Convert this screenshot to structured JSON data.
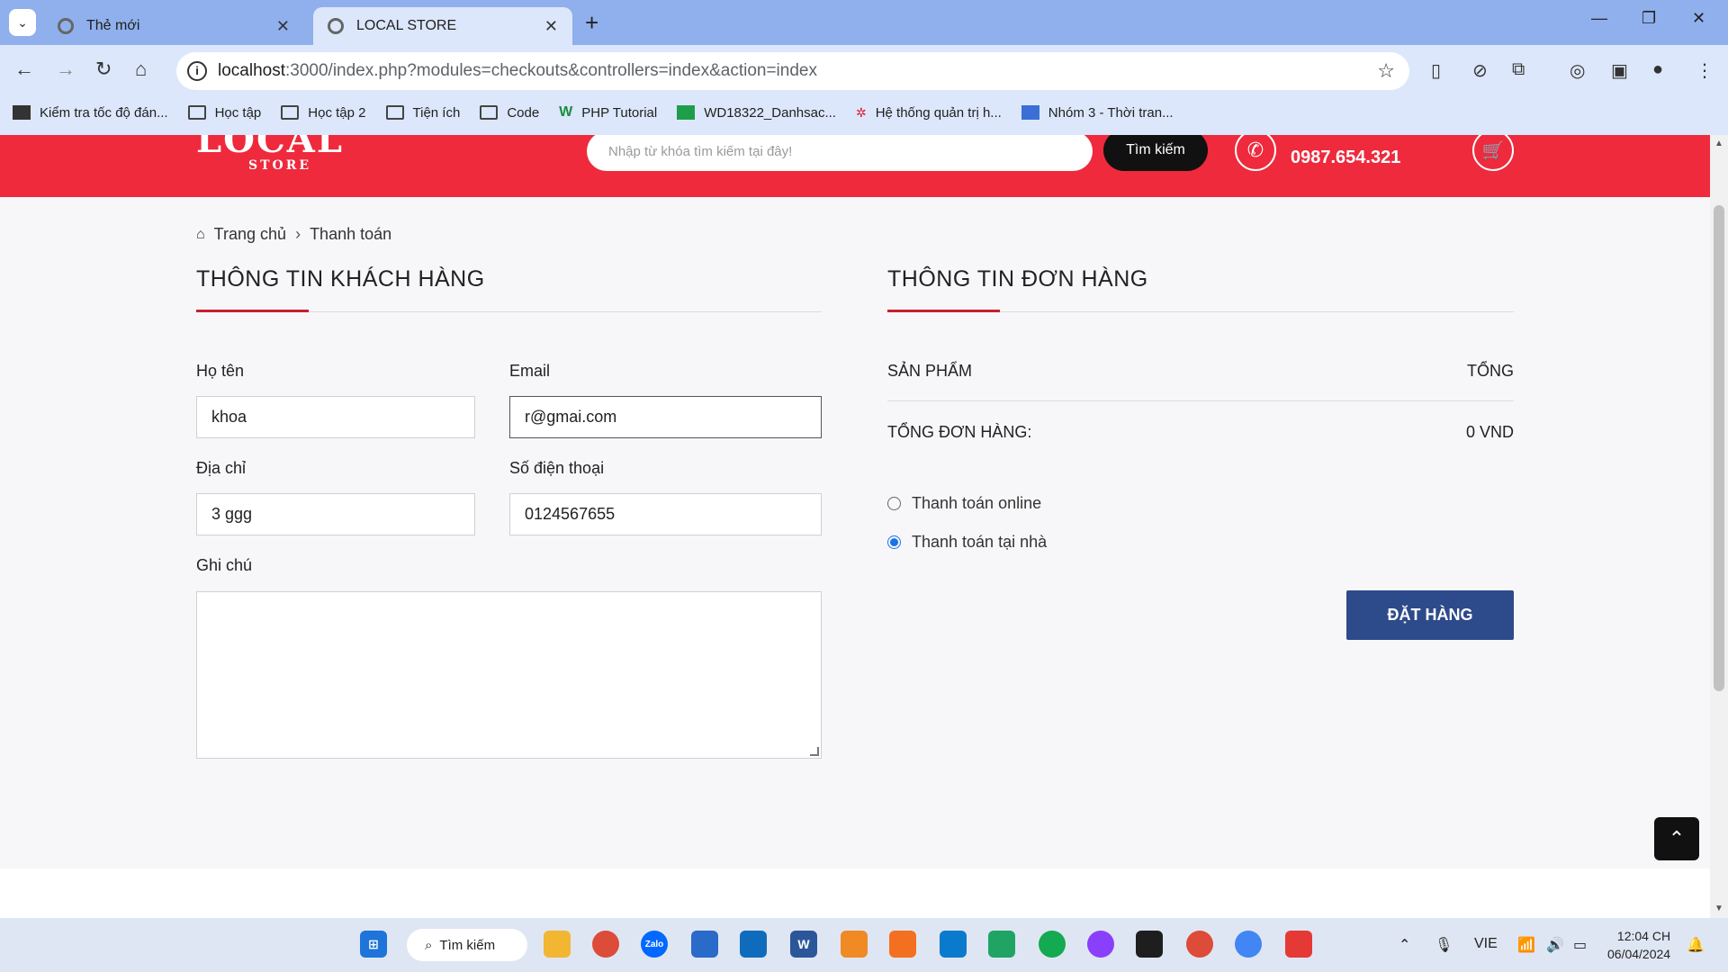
{
  "browser": {
    "tabs": [
      {
        "title": "Thẻ mới",
        "active": false
      },
      {
        "title": "LOCAL STORE",
        "active": true
      }
    ],
    "url_host": "localhost",
    "url_rest": ":3000/index.php?modules=checkouts&controllers=index&action=index",
    "bookmarks": [
      "Kiểm tra tốc độ đán...",
      "Học tập",
      "Học tập 2",
      "Tiện ích",
      "Code",
      "PHP Tutorial",
      "WD18322_Danhsac...",
      "Hệ thống quản trị h...",
      "Nhóm 3 - Thời tran..."
    ]
  },
  "header": {
    "logo_main": "LOCAL",
    "logo_sub": "STORE",
    "search_placeholder": "Nhập từ khóa tìm kiếm tại đây!",
    "search_button": "Tìm kiếm",
    "phone": "0987.654.321"
  },
  "breadcrumb": {
    "home": "Trang chủ",
    "current": "Thanh toán"
  },
  "customer": {
    "title": "THÔNG TIN KHÁCH HÀNG",
    "name_label": "Họ tên",
    "name_value": "khoa",
    "email_label": "Email",
    "email_value": "r@gmai.com",
    "address_label": "Địa chỉ",
    "address_value": "3 ggg",
    "phone_label": "Số điện thoại",
    "phone_value": "0124567655",
    "note_label": "Ghi chú"
  },
  "order": {
    "title": "THÔNG TIN ĐƠN HÀNG",
    "col_product": "SẢN PHẨM",
    "col_total": "TỔNG",
    "total_label": "TỔNG ĐƠN HÀNG:",
    "total_value": "0 VND",
    "pay_online": "Thanh toán online",
    "pay_home": "Thanh toán tại nhà",
    "selected_payment": "pay_home",
    "submit": "ĐẶT HÀNG"
  },
  "taskbar": {
    "search": "Tìm kiếm",
    "lang": "VIE",
    "time": "12:04 CH",
    "date": "06/04/2024"
  },
  "colors": {
    "header_red": "#ee2a3c",
    "accent_red": "#c8202f",
    "button_blue": "#2d4a8a"
  }
}
